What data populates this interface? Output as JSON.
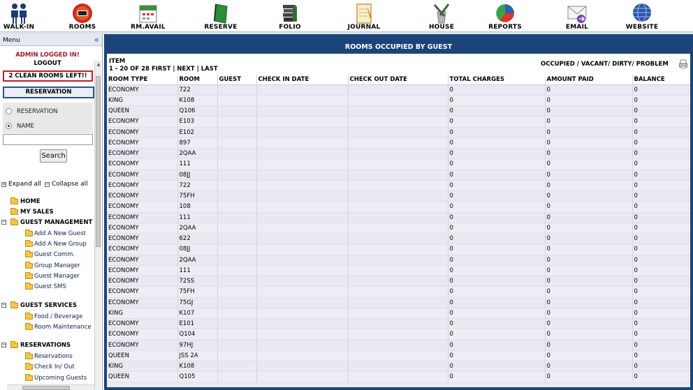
{
  "toolbar": {
    "items": [
      {
        "label": "WALK-IN",
        "icon": "walk-in-people-icon"
      },
      {
        "label": "ROOMS",
        "icon": "rooms-icon"
      },
      {
        "label": "RM.AVAIL",
        "icon": "calendar-icon"
      },
      {
        "label": "RESERVE",
        "icon": "book-icon"
      },
      {
        "label": "FOLIO",
        "icon": "stacked-folio-icon"
      },
      {
        "label": "JOURNAL",
        "icon": "notepad-icon"
      },
      {
        "label": "HOUSE",
        "icon": "housekeeping-tools-icon"
      },
      {
        "label": "REPORTS",
        "icon": "pie-chart-icon"
      },
      {
        "label": "EMAIL",
        "icon": "envelope-icon"
      },
      {
        "label": "WEBSITE",
        "icon": "globe-icon"
      }
    ]
  },
  "sidebar": {
    "menu_title": "Menu",
    "collapse_glyph": "«",
    "admin_text": "ADMIN LOGGED IN!",
    "logout_label": "LOGOUT",
    "clean_rooms_text": "2 CLEAN ROOMS LEFT!!",
    "reservation_label": "RESERVATION",
    "radio_options": [
      {
        "label": "RESERVATION",
        "selected": false
      },
      {
        "label": "NAME",
        "selected": true
      }
    ],
    "search_value": "",
    "search_button_label": "Search",
    "expand_all_label": "Expand all",
    "collapse_all_label": "Collapse all",
    "tree": {
      "home": "HOME",
      "my_sales": "MY SALES",
      "guest_management": "GUEST MANAGEMENT",
      "guest_management_items": [
        "Add A New Guest",
        "Add A New Group",
        "Guest Comm.",
        "Group Manager",
        "Guest Manager",
        "Guest SMS"
      ],
      "guest_services": "GUEST SERVICES",
      "guest_services_items": [
        "Food / Beverage",
        "Room Maintenance"
      ],
      "reservations": "RESERVATIONS",
      "reservations_items": [
        "Reservations",
        "Check In/ Out",
        "Upcoming Guests"
      ]
    }
  },
  "main": {
    "title": "ROOMS OCCUPIED BY GUEST",
    "item_label": "ITEM",
    "range_text": "1 - 20 OF 28",
    "pager": {
      "first": "FIRST",
      "next": "NEXT",
      "last": "LAST"
    },
    "status_links": "OCCUPIED / VACANT/ DIRTY/ PROBLEM",
    "columns": [
      "ROOM TYPE",
      "ROOM",
      "GUEST",
      "CHECK IN DATE",
      "CHECK OUT DATE",
      "TOTAL CHARGES",
      "AMOUNT PAID",
      "BALANCE"
    ],
    "rows": [
      [
        "ECONOMY",
        "722",
        "",
        "",
        "",
        "0",
        "0",
        "0"
      ],
      [
        "KING",
        "K108",
        "",
        "",
        "",
        "0",
        "0",
        "0"
      ],
      [
        "QUEEN",
        "Q106",
        "",
        "",
        "",
        "0",
        "0",
        "0"
      ],
      [
        "ECONOMY",
        "E103",
        "",
        "",
        "",
        "0",
        "0",
        "0"
      ],
      [
        "ECONOMY",
        "E102",
        "",
        "",
        "",
        "0",
        "0",
        "0"
      ],
      [
        "ECONOMY",
        "897",
        "",
        "",
        "",
        "0",
        "0",
        "0"
      ],
      [
        "ECONOMY",
        "2QAA",
        "",
        "",
        "",
        "0",
        "0",
        "0"
      ],
      [
        "ECONOMY",
        "111",
        "",
        "",
        "",
        "0",
        "0",
        "0"
      ],
      [
        "ECONOMY",
        "08JJ",
        "",
        "",
        "",
        "0",
        "0",
        "0"
      ],
      [
        "ECONOMY",
        "722",
        "",
        "",
        "",
        "0",
        "0",
        "0"
      ],
      [
        "ECONOMY",
        "75FH",
        "",
        "",
        "",
        "0",
        "0",
        "0"
      ],
      [
        "ECONOMY",
        "108",
        "",
        "",
        "",
        "0",
        "0",
        "0"
      ],
      [
        "ECONOMY",
        "111",
        "",
        "",
        "",
        "0",
        "0",
        "0"
      ],
      [
        "ECONOMY",
        "2QAA",
        "",
        "",
        "",
        "0",
        "0",
        "0"
      ],
      [
        "ECONOMY",
        "622",
        "",
        "",
        "",
        "0",
        "0",
        "0"
      ],
      [
        "ECONOMY",
        "08JJ",
        "",
        "",
        "",
        "0",
        "0",
        "0"
      ],
      [
        "ECONOMY",
        "2QAA",
        "",
        "",
        "",
        "0",
        "0",
        "0"
      ],
      [
        "ECONOMY",
        "111",
        "",
        "",
        "",
        "0",
        "0",
        "0"
      ],
      [
        "ECONOMY",
        "72SS",
        "",
        "",
        "",
        "0",
        "0",
        "0"
      ],
      [
        "ECONOMY",
        "75FH",
        "",
        "",
        "",
        "0",
        "0",
        "0"
      ],
      [
        "ECONOMY",
        "75GJ",
        "",
        "",
        "",
        "0",
        "0",
        "0"
      ],
      [
        "KING",
        "K107",
        "",
        "",
        "",
        "0",
        "0",
        "0"
      ],
      [
        "ECONOMY",
        "E101",
        "",
        "",
        "",
        "0",
        "0",
        "0"
      ],
      [
        "ECONOMY",
        "Q104",
        "",
        "",
        "",
        "0",
        "0",
        "0"
      ],
      [
        "ECONOMY",
        "97HJ",
        "",
        "",
        "",
        "0",
        "0",
        "0"
      ],
      [
        "QUEEN",
        "JSS 2A",
        "",
        "",
        "",
        "0",
        "0",
        "0"
      ],
      [
        "KING",
        "K108",
        "",
        "",
        "",
        "0",
        "0",
        "0"
      ],
      [
        "QUEEN",
        "Q105",
        "",
        "",
        "",
        "0",
        "0",
        "0"
      ]
    ]
  },
  "colors": {
    "header_blue": "#1b4578",
    "admin_red": "#a0182a",
    "alert_border": "#c01c30",
    "folder_yellow": "#f2c74a"
  }
}
